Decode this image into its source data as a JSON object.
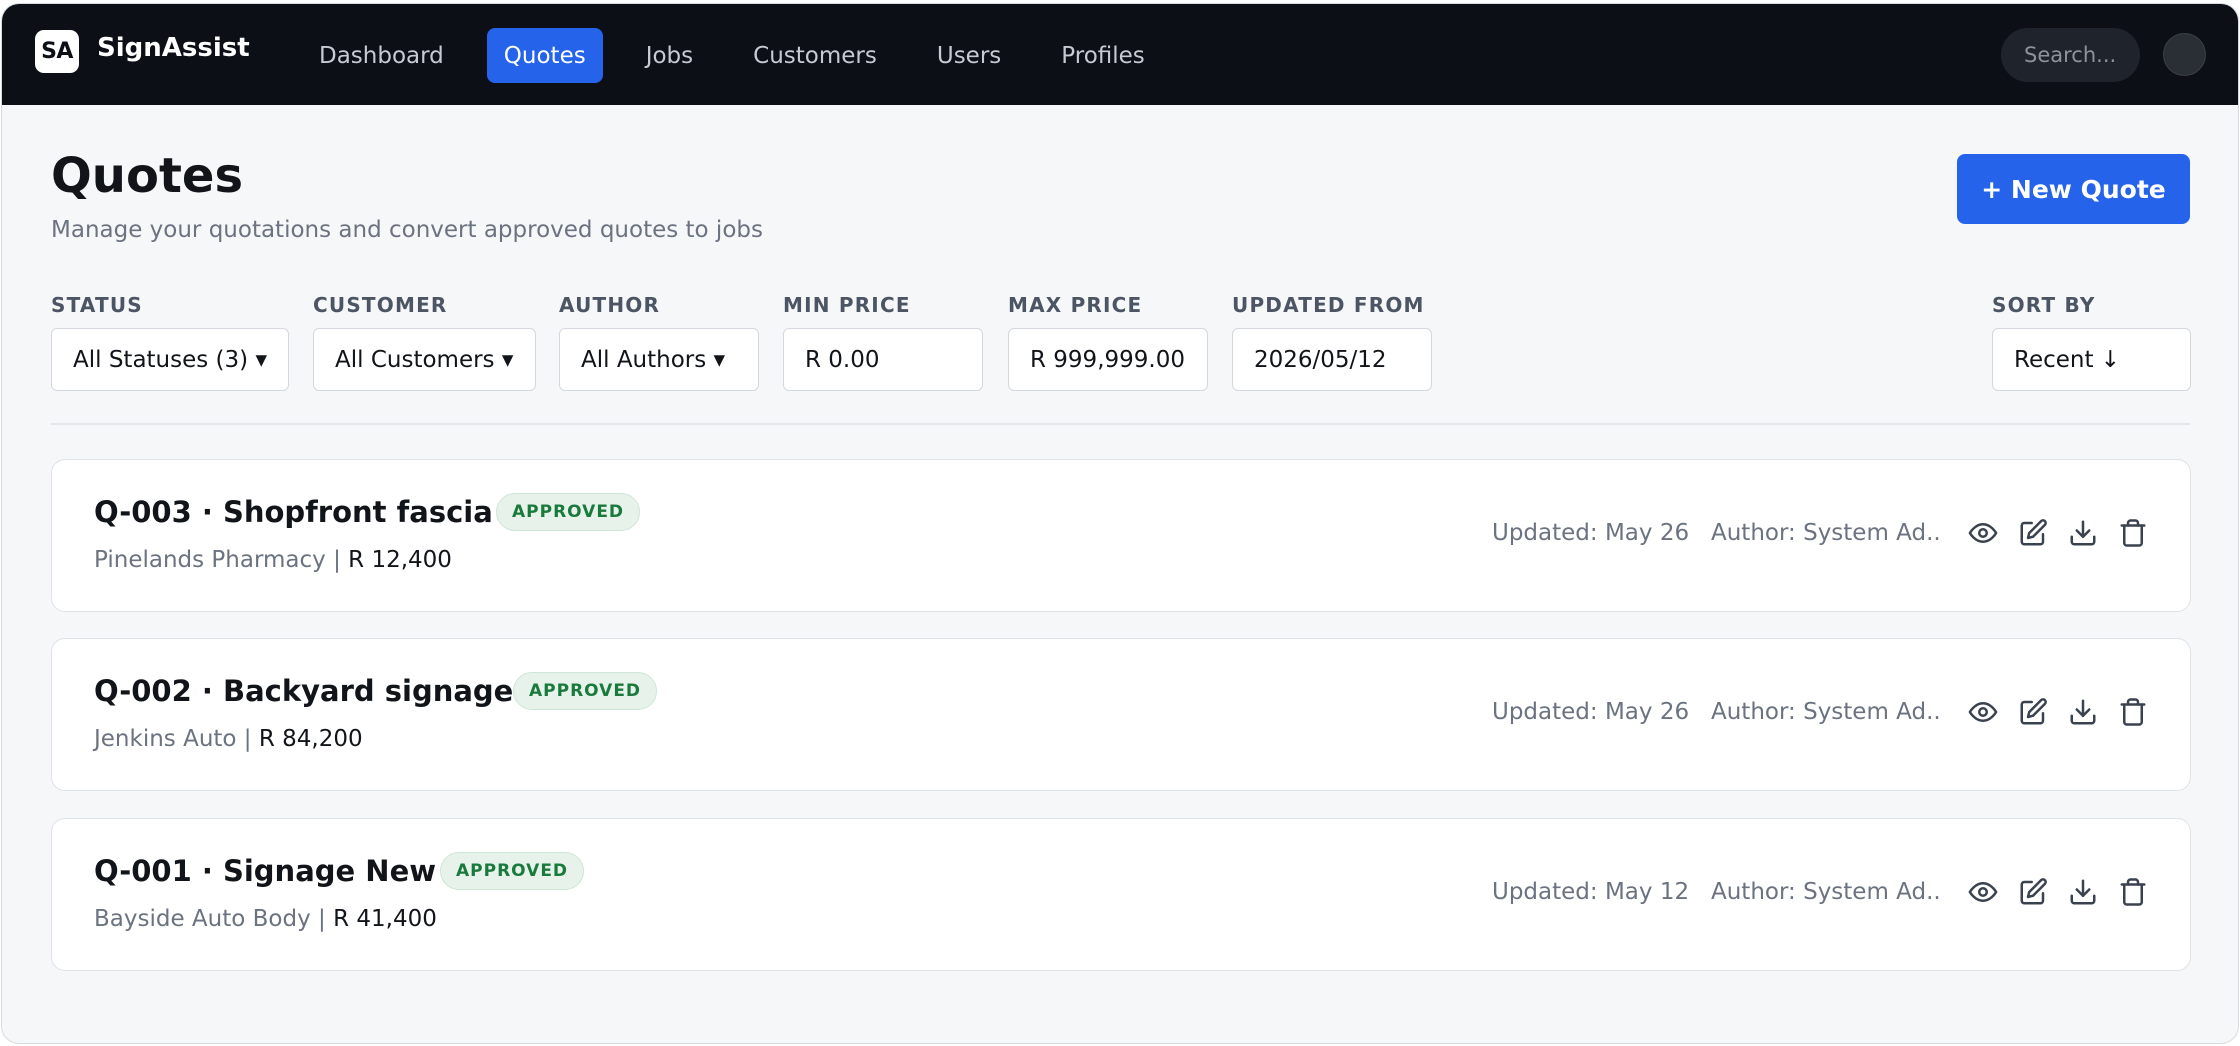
{
  "app": {
    "logo_text": "SA",
    "name": "SignAssist"
  },
  "nav": {
    "items": [
      {
        "label": "Dashboard",
        "active": false
      },
      {
        "label": "Quotes",
        "active": true
      },
      {
        "label": "Jobs",
        "active": false
      },
      {
        "label": "Customers",
        "active": false
      },
      {
        "label": "Users",
        "active": false
      },
      {
        "label": "Profiles",
        "active": false
      }
    ],
    "search_placeholder": "Search..."
  },
  "header": {
    "title": "Quotes",
    "subtitle": "Manage your quotations and convert approved quotes to jobs",
    "new_button": "+ New Quote"
  },
  "filters": {
    "status": {
      "label": "STATUS",
      "value": "All Statuses (3) ▾"
    },
    "customer": {
      "label": "CUSTOMER",
      "value": "All Customers ▾"
    },
    "author": {
      "label": "AUTHOR",
      "value": "All Authors ▾"
    },
    "min_price": {
      "label": "MIN PRICE",
      "value": "R 0.00"
    },
    "max_price": {
      "label": "MAX PRICE",
      "value": "R 999,999.00"
    },
    "updated_from": {
      "label": "UPDATED FROM",
      "value": "2026/05/12"
    },
    "sort_by": {
      "label": "SORT BY",
      "value": "Recent ↓"
    }
  },
  "quotes": [
    {
      "title": "Q-003 · Shopfront fascia",
      "status": "APPROVED",
      "customer": "Pinelands Pharmacy",
      "separator": " | ",
      "price": "R 12,400",
      "updated": "Updated: May 26",
      "author": "Author: System Ad..."
    },
    {
      "title": "Q-002 · Backyard signage",
      "status": "APPROVED",
      "customer": "Jenkins Auto",
      "separator": " | ",
      "price": "R 84,200",
      "updated": "Updated: May 26",
      "author": "Author: System Ad..."
    },
    {
      "title": "Q-001 · Signage New",
      "status": "APPROVED",
      "customer": "Bayside Auto Body",
      "separator": " | ",
      "price": "R 41,400",
      "updated": "Updated: May 12",
      "author": "Author: System Ad..."
    }
  ],
  "colors": {
    "accent": "#2563eb",
    "topbar": "#0c1016",
    "approved_text": "#1a7a3c",
    "approved_bg": "#e6f2ea"
  },
  "icons": {
    "row_actions": [
      "eye-icon",
      "edit-icon",
      "download-icon",
      "trash-icon"
    ]
  }
}
